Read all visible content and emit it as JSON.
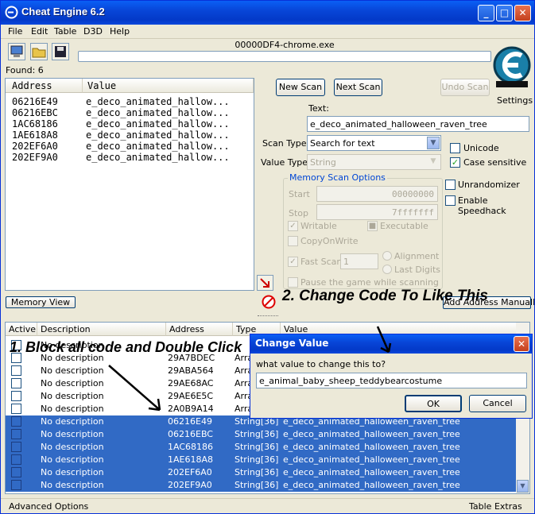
{
  "window": {
    "title": "Cheat Engine 6.2"
  },
  "menu": [
    "File",
    "Edit",
    "Table",
    "D3D",
    "Help"
  ],
  "process": "00000DF4-chrome.exe",
  "found": "Found: 6",
  "logo_label": "Settings",
  "results": {
    "headers": [
      "Address",
      "Value"
    ],
    "rows": [
      {
        "address": "06216E49",
        "value": "e_deco_animated_hallow..."
      },
      {
        "address": "06216EBC",
        "value": "e_deco_animated_hallow..."
      },
      {
        "address": "1AC68186",
        "value": "e_deco_animated_hallow..."
      },
      {
        "address": "1AE618A8",
        "value": "e_deco_animated_hallow..."
      },
      {
        "address": "202EF6A0",
        "value": "e_deco_animated_hallow..."
      },
      {
        "address": "202EF9A0",
        "value": "e_deco_animated_hallow..."
      }
    ]
  },
  "buttons": {
    "new_scan": "New Scan",
    "next_scan": "Next Scan",
    "undo_scan": "Undo Scan",
    "memory_view": "Memory View",
    "add_address": "Add Address Manually"
  },
  "scan": {
    "text_label": "Text:",
    "text_value": "e_deco_animated_halloween_raven_tree",
    "scan_type_label": "Scan Type",
    "scan_type_value": "Search for text",
    "value_type_label": "Value Type",
    "value_type_value": "String",
    "unicode": "Unicode",
    "case_sensitive": "Case sensitive",
    "unrandomizer": "Unrandomizer",
    "speedhack": "Enable Speedhack"
  },
  "memory": {
    "title": "Memory Scan Options",
    "start_label": "Start",
    "start_value": "00000000",
    "stop_label": "Stop",
    "stop_value": "7fffffff",
    "writable": "Writable",
    "executable": "Executable",
    "copyonwrite": "CopyOnWrite",
    "fastscan": "Fast Scan",
    "fastscan_value": "1",
    "alignment": "Alignment",
    "lastdigits": "Last Digits",
    "pause": "Pause the game while scanning"
  },
  "table": {
    "headers": [
      "Active",
      "Description",
      "Address",
      "Type",
      "Value"
    ],
    "rows": [
      {
        "desc": "No description",
        "address": "",
        "type": "",
        "value": "",
        "sel": false
      },
      {
        "desc": "No description",
        "address": "29A7BDEC",
        "type": "Arra",
        "value": "",
        "sel": false
      },
      {
        "desc": "No description",
        "address": "29ABA564",
        "type": "Arra",
        "value": "",
        "sel": false
      },
      {
        "desc": "No description",
        "address": "29AE68AC",
        "type": "Arra",
        "value": "",
        "sel": false
      },
      {
        "desc": "No description",
        "address": "29AE6E5C",
        "type": "Arra",
        "value": "",
        "sel": false
      },
      {
        "desc": "No description",
        "address": "2A0B9A14",
        "type": "Arra",
        "value": "",
        "sel": false
      },
      {
        "desc": "No description",
        "address": "06216E49",
        "type": "String[36]",
        "value": "e_deco_animated_halloween_raven_tree",
        "sel": true
      },
      {
        "desc": "No description",
        "address": "06216EBC",
        "type": "String[36]",
        "value": "e_deco_animated_halloween_raven_tree",
        "sel": true
      },
      {
        "desc": "No description",
        "address": "1AC68186",
        "type": "String[36]",
        "value": "e_deco_animated_halloween_raven_tree",
        "sel": true
      },
      {
        "desc": "No description",
        "address": "1AE618A8",
        "type": "String[36]",
        "value": "e_deco_animated_halloween_raven_tree",
        "sel": true
      },
      {
        "desc": "No description",
        "address": "202EF6A0",
        "type": "String[36]",
        "value": "e_deco_animated_halloween_raven_tree",
        "sel": true
      },
      {
        "desc": "No description",
        "address": "202EF9A0",
        "type": "String[36]",
        "value": "e_deco_animated_halloween_raven_tree",
        "sel": true
      }
    ]
  },
  "annotations": {
    "one": "1. Block all code and Double Click",
    "two": "2. Change Code To Like This"
  },
  "dialog": {
    "title": "Change Value",
    "prompt": "what value to change this to?",
    "value": "e_animal_baby_sheep_teddybearcostume",
    "ok": "OK",
    "cancel": "Cancel"
  },
  "status": {
    "left": "Advanced Options",
    "right": "Table Extras"
  },
  "colors": {
    "titlebar": "#0846d8",
    "selection": "#316ac5",
    "face": "#ece9d8"
  }
}
